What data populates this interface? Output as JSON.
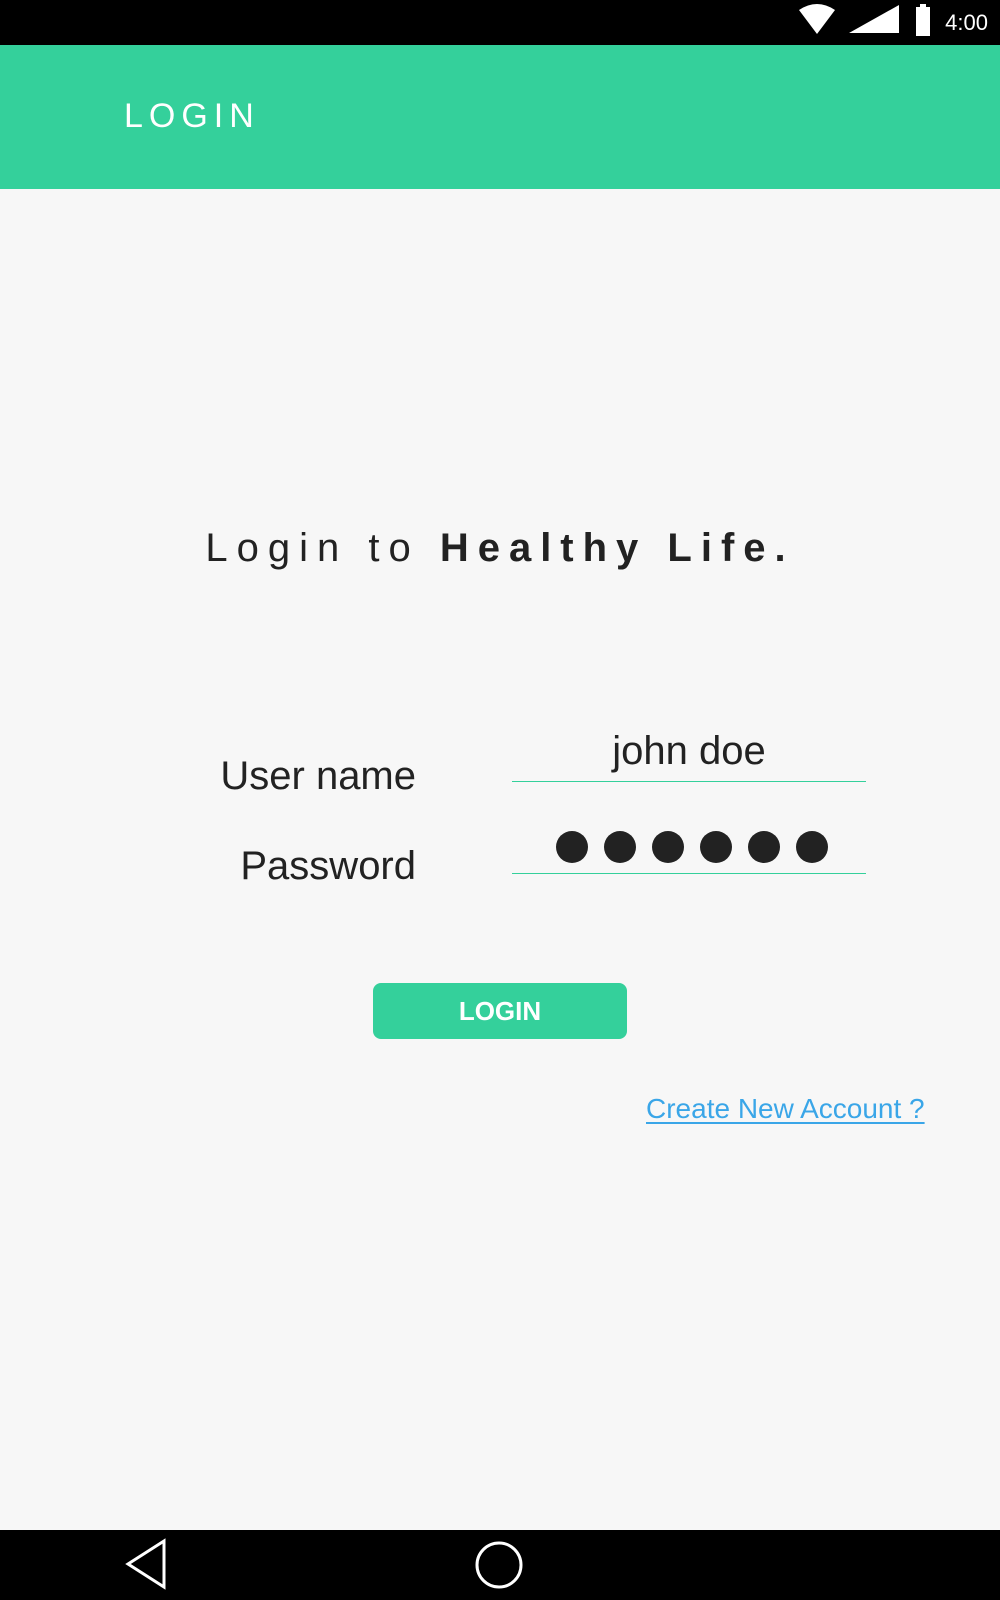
{
  "status_bar": {
    "time": "4:00",
    "icons": [
      "wifi-icon",
      "signal-icon",
      "battery-icon"
    ]
  },
  "app_bar": {
    "title": "LOGIN",
    "color": "#34d09b"
  },
  "headline": {
    "prefix": "Login to ",
    "brand": "Healthy Life."
  },
  "form": {
    "username_label": "User name",
    "username_value": "john doe",
    "password_label": "Password",
    "password_masked_length": 6,
    "login_button": "LOGIN",
    "create_account_link": "Create New Account ?"
  },
  "nav_bar": {
    "icons": [
      "back-icon",
      "home-icon"
    ]
  },
  "colors": {
    "accent": "#34d09b",
    "link": "#3aa6e8",
    "background": "#f7f7f7"
  }
}
